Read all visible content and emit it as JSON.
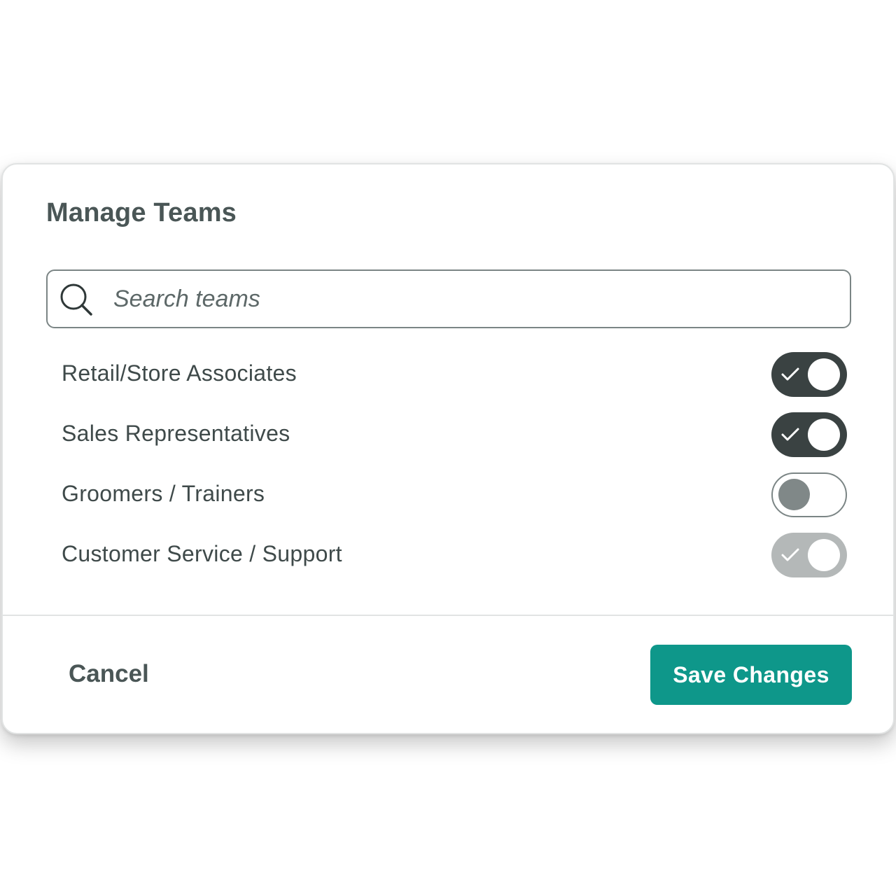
{
  "dialog": {
    "title": "Manage Teams"
  },
  "search": {
    "placeholder": "Search teams",
    "icon": "search-icon"
  },
  "teams": [
    {
      "label": "Retail/Store Associates",
      "state": "on"
    },
    {
      "label": "Sales Representatives",
      "state": "on"
    },
    {
      "label": "Groomers / Trainers",
      "state": "off"
    },
    {
      "label": "Customer Service / Support",
      "state": "disabled-on"
    }
  ],
  "footer": {
    "cancel_label": "Cancel",
    "save_label": "Save Changes"
  },
  "colors": {
    "accent": "#0e978a",
    "toggle_on": "#3a4242",
    "toggle_disabled": "#b4b8b8",
    "text": "#4a5656"
  }
}
